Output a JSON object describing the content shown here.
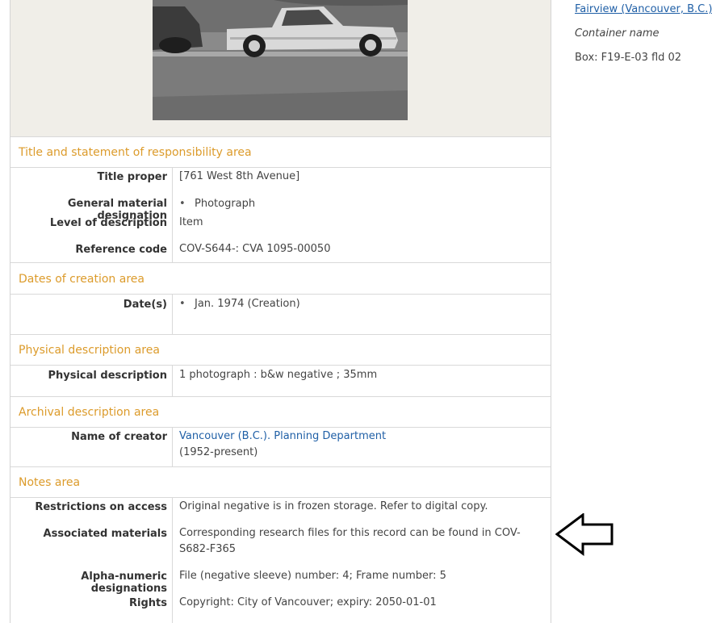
{
  "sidebar": {
    "place_link": "Fairview (Vancouver, B.C.)",
    "container_label": "Container name",
    "container_value": "Box: F19-E-03 fld 02"
  },
  "sections": {
    "title": {
      "heading": "Title and statement of responsibility area",
      "title_proper_label": "Title proper",
      "title_proper_value": "[761 West 8th Avenue]",
      "gmd_label": "General material designation",
      "gmd_value": "Photograph",
      "level_label": "Level of description",
      "level_value": "Item",
      "ref_label": "Reference code",
      "ref_value": "COV-S644-: CVA 1095-00050"
    },
    "dates": {
      "heading": "Dates of creation area",
      "dates_label": "Date(s)",
      "dates_value": "Jan. 1974 (Creation)"
    },
    "physical": {
      "heading": "Physical description area",
      "phys_label": "Physical description",
      "phys_value": "1 photograph : b&w negative ; 35mm"
    },
    "archival": {
      "heading": "Archival description area",
      "creator_label": "Name of creator",
      "creator_link": "Vancouver (B.C.). Planning Department",
      "creator_dates": "(1952-present)"
    },
    "notes": {
      "heading": "Notes area",
      "restrictions_label": "Restrictions on access",
      "restrictions_value": "Original negative is in frozen storage. Refer to digital copy.",
      "associated_label": "Associated materials",
      "associated_value_line1": "Corresponding research files for this record can be found in COV-",
      "associated_value_line2": "S682-F365",
      "alpha_label": "Alpha-numeric designations",
      "alpha_value": "File (negative sleeve) number: 4; Frame number: 5",
      "rights_label": "Rights",
      "rights_value": "Copyright: City of Vancouver; expiry: 2050-01-01"
    }
  },
  "icons": {
    "pointer": "left-arrow-icon"
  },
  "colors": {
    "heading": "#dc9b2b",
    "link": "#1f5fa6",
    "border": "#d9d9d9",
    "image_bg": "#f0eee8"
  }
}
